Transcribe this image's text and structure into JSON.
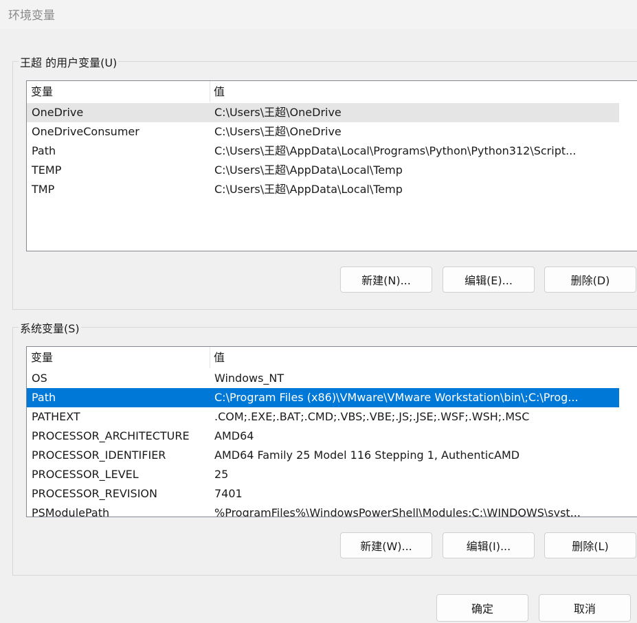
{
  "window": {
    "title": "环境变量"
  },
  "user_vars": {
    "group_label": "王超 的用户变量(U)",
    "columns": [
      "变量",
      "值"
    ],
    "rows": [
      {
        "name": "OneDrive",
        "value": "C:\\Users\\王超\\OneDrive"
      },
      {
        "name": "OneDriveConsumer",
        "value": "C:\\Users\\王超\\OneDrive"
      },
      {
        "name": "Path",
        "value": "C:\\Users\\王超\\AppData\\Local\\Programs\\Python\\Python312\\Script..."
      },
      {
        "name": "TEMP",
        "value": "C:\\Users\\王超\\AppData\\Local\\Temp"
      },
      {
        "name": "TMP",
        "value": "C:\\Users\\王超\\AppData\\Local\\Temp"
      }
    ],
    "buttons": {
      "new": "新建(N)...",
      "edit": "编辑(E)...",
      "delete": "删除(D)"
    }
  },
  "system_vars": {
    "group_label": "系统变量(S)",
    "columns": [
      "变量",
      "值"
    ],
    "rows": [
      {
        "name": "OS",
        "value": "Windows_NT"
      },
      {
        "name": "Path",
        "value": "C:\\Program Files (x86)\\VMware\\VMware Workstation\\bin\\;C:\\Prog..."
      },
      {
        "name": "PATHEXT",
        "value": ".COM;.EXE;.BAT;.CMD;.VBS;.VBE;.JS;.JSE;.WSF;.WSH;.MSC"
      },
      {
        "name": "PROCESSOR_ARCHITECTURE",
        "value": "AMD64"
      },
      {
        "name": "PROCESSOR_IDENTIFIER",
        "value": "AMD64 Family 25 Model 116 Stepping 1, AuthenticAMD"
      },
      {
        "name": "PROCESSOR_LEVEL",
        "value": "25"
      },
      {
        "name": "PROCESSOR_REVISION",
        "value": "7401"
      },
      {
        "name": "PSModulePath",
        "value": "%ProgramFiles%\\WindowsPowerShell\\Modules;C:\\WINDOWS\\syst..."
      }
    ],
    "buttons": {
      "new": "新建(W)...",
      "edit": "编辑(I)...",
      "delete": "删除(L)"
    }
  },
  "dialog_buttons": {
    "ok": "确定",
    "cancel": "取消"
  },
  "colors": {
    "selection": "#0078d7",
    "hover": "#e5e5e5"
  }
}
